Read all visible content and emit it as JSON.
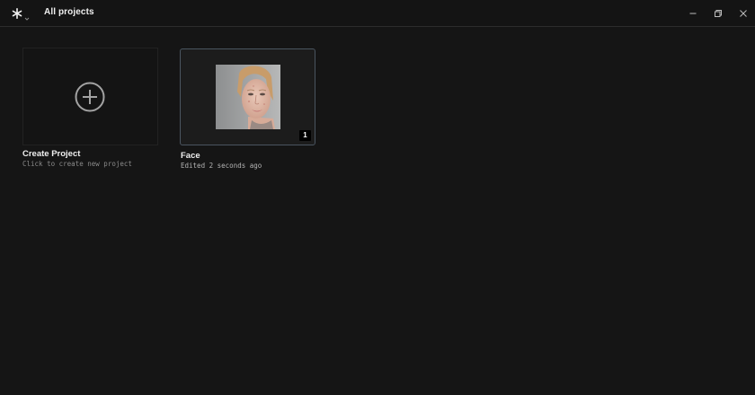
{
  "titlebar": {
    "logo_icon": "asterisk-star-icon",
    "menu_icon": "chevron-down-icon",
    "title": "All projects",
    "minimize_icon": "minimize-icon",
    "restore_icon": "restore-icon",
    "close_icon": "close-icon"
  },
  "create_card": {
    "icon": "plus-circle-icon",
    "title": "Create Project",
    "subtitle": "Click to create new project"
  },
  "projects": [
    {
      "name": "Face",
      "edited": "Edited 2 seconds ago",
      "count": "1",
      "thumbnail": "face-portrait-thumbnail"
    }
  ],
  "colors": {
    "background": "#151515",
    "card_border_selected": "#4a5560",
    "badge_bg": "#000000"
  }
}
